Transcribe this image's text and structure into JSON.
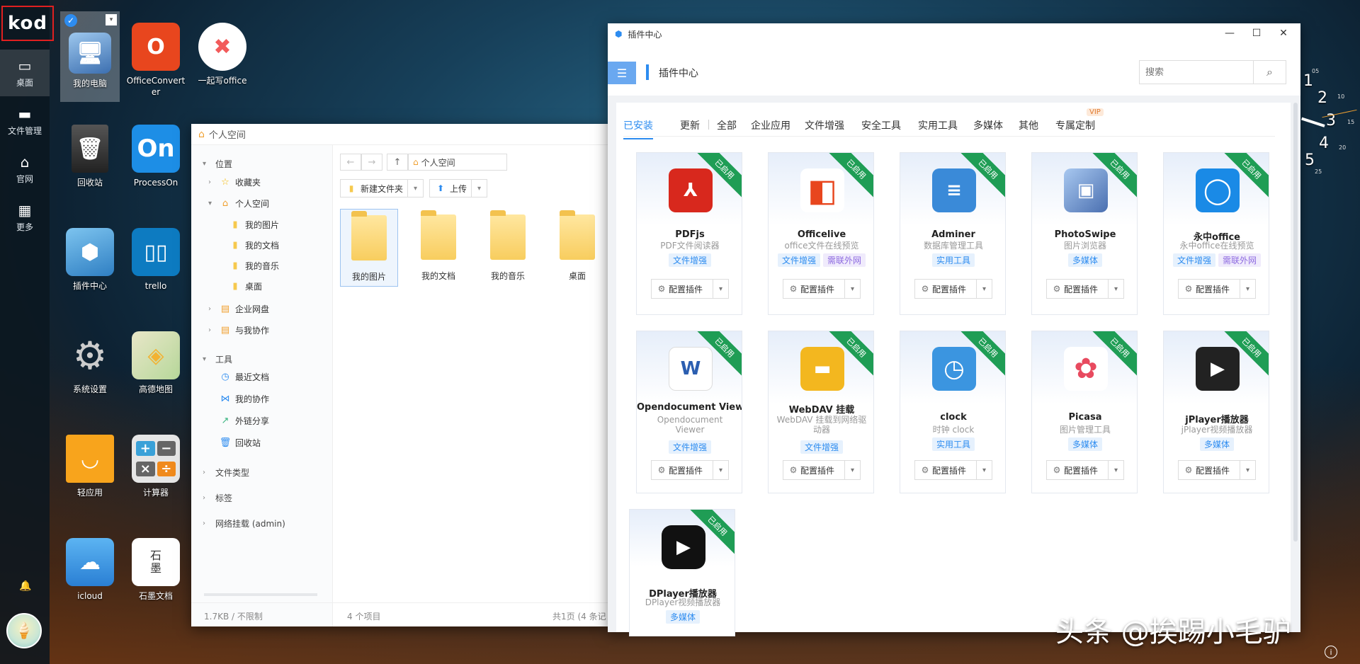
{
  "sidebar": {
    "logo": "kod",
    "items": [
      {
        "label": "桌面",
        "icon": "monitor-icon"
      },
      {
        "label": "文件管理",
        "icon": "folder-icon"
      },
      {
        "label": "官网",
        "icon": "home-icon"
      },
      {
        "label": "更多",
        "icon": "grid-icon"
      }
    ]
  },
  "desktop": {
    "icons": [
      {
        "label": "我的电脑"
      },
      {
        "label": "OfficeConverter"
      },
      {
        "label": "一起写office"
      },
      {
        "label": "回收站"
      },
      {
        "label": "ProcessOn"
      },
      {
        "label": "插件中心"
      },
      {
        "label": "trello"
      },
      {
        "label": "系统设置"
      },
      {
        "label": "高德地图"
      },
      {
        "label": "轻应用"
      },
      {
        "label": "计算器"
      },
      {
        "label": "icloud"
      },
      {
        "label": "石墨文档"
      }
    ],
    "icon_glyphs": {
      "processon": "On",
      "shimo": "石\n墨"
    }
  },
  "file_manager": {
    "title": "个人空间",
    "tree": {
      "location": "位置",
      "favorites": "收藏夹",
      "personal": "个人空间",
      "sub": [
        "我的图片",
        "我的文档",
        "我的音乐",
        "桌面"
      ],
      "enterprise": "企业网盘",
      "collab": "与我协作",
      "tools": "工具",
      "tool_items": [
        "最近文档",
        "我的协作",
        "外链分享",
        "回收站"
      ],
      "file_types": "文件类型",
      "tags": "标签",
      "network": "网络挂载 (admin)"
    },
    "path": "个人空间",
    "new_folder": "新建文件夹",
    "upload": "上传",
    "folders": [
      "我的图片",
      "我的文档",
      "我的音乐",
      "桌面"
    ],
    "footer": {
      "quota": "1.7KB / 不限制",
      "count": "4 个项目",
      "page": "共1页 (4 条记"
    }
  },
  "plugin_center": {
    "window_title": "插件中心",
    "header_title": "插件中心",
    "search_placeholder": "搜索",
    "tabs": [
      "已安装",
      "更新",
      "全部",
      "企业应用",
      "文件增强",
      "安全工具",
      "实用工具",
      "多媒体",
      "其他",
      "专属定制"
    ],
    "vip": "VIP",
    "ribbon": "已启用",
    "config_label": "配置插件",
    "plugins": [
      {
        "name": "PDFjs",
        "desc": "PDF文件阅读器",
        "tags": [
          "文件增强"
        ],
        "color": "#d8281d",
        "glyph": "A"
      },
      {
        "name": "Officelive",
        "desc": "office文件在线预览",
        "tags": [
          "文件增强",
          "需联外网"
        ],
        "color": "#e8461e",
        "glyph": "O"
      },
      {
        "name": "Adminer",
        "desc": "数据库管理工具",
        "tags": [
          "实用工具"
        ],
        "color": "#3a8ad8",
        "glyph": "≡"
      },
      {
        "name": "PhotoSwipe",
        "desc": "图片浏览器",
        "tags": [
          "多媒体"
        ],
        "color": "#5b7fb8",
        "glyph": "▣"
      },
      {
        "name": "永中office",
        "desc": "永中office在线预览",
        "tags": [
          "文件增强",
          "需联外网"
        ],
        "color": "#1a8ae6",
        "glyph": "O"
      },
      {
        "name": "Opendocument Viewer",
        "desc": "Opendocument Viewer",
        "tags": [
          "文件增强"
        ],
        "color": "#2b5eb0",
        "glyph": "W"
      },
      {
        "name": "WebDAV 挂载",
        "desc": "WebDAV 挂载到网络驱动器",
        "tags": [
          "文件增强"
        ],
        "color": "#f3b71f",
        "glyph": "▬"
      },
      {
        "name": "clock",
        "desc": "时钟 clock",
        "tags": [
          "实用工具"
        ],
        "color": "#3b95e0",
        "glyph": "◷"
      },
      {
        "name": "Picasa",
        "desc": "图片管理工具",
        "tags": [
          "多媒体"
        ],
        "color": "#ffffff",
        "glyph": "✿"
      },
      {
        "name": "jPlayer播放器",
        "desc": "jPlayer视频播放器",
        "tags": [
          "多媒体"
        ],
        "color": "#222222",
        "glyph": "▶"
      },
      {
        "name": "DPlayer播放器",
        "desc": "DPlayer视频播放器",
        "tags": [
          "多媒体"
        ],
        "color": "#111111",
        "glyph": "▶"
      }
    ]
  },
  "clock": {
    "numbers": [
      "1",
      "2",
      "3",
      "4",
      "5"
    ],
    "small": [
      "05",
      "10",
      "15",
      "20",
      "25"
    ]
  },
  "watermark": "头条 @挨踢小毛驴"
}
